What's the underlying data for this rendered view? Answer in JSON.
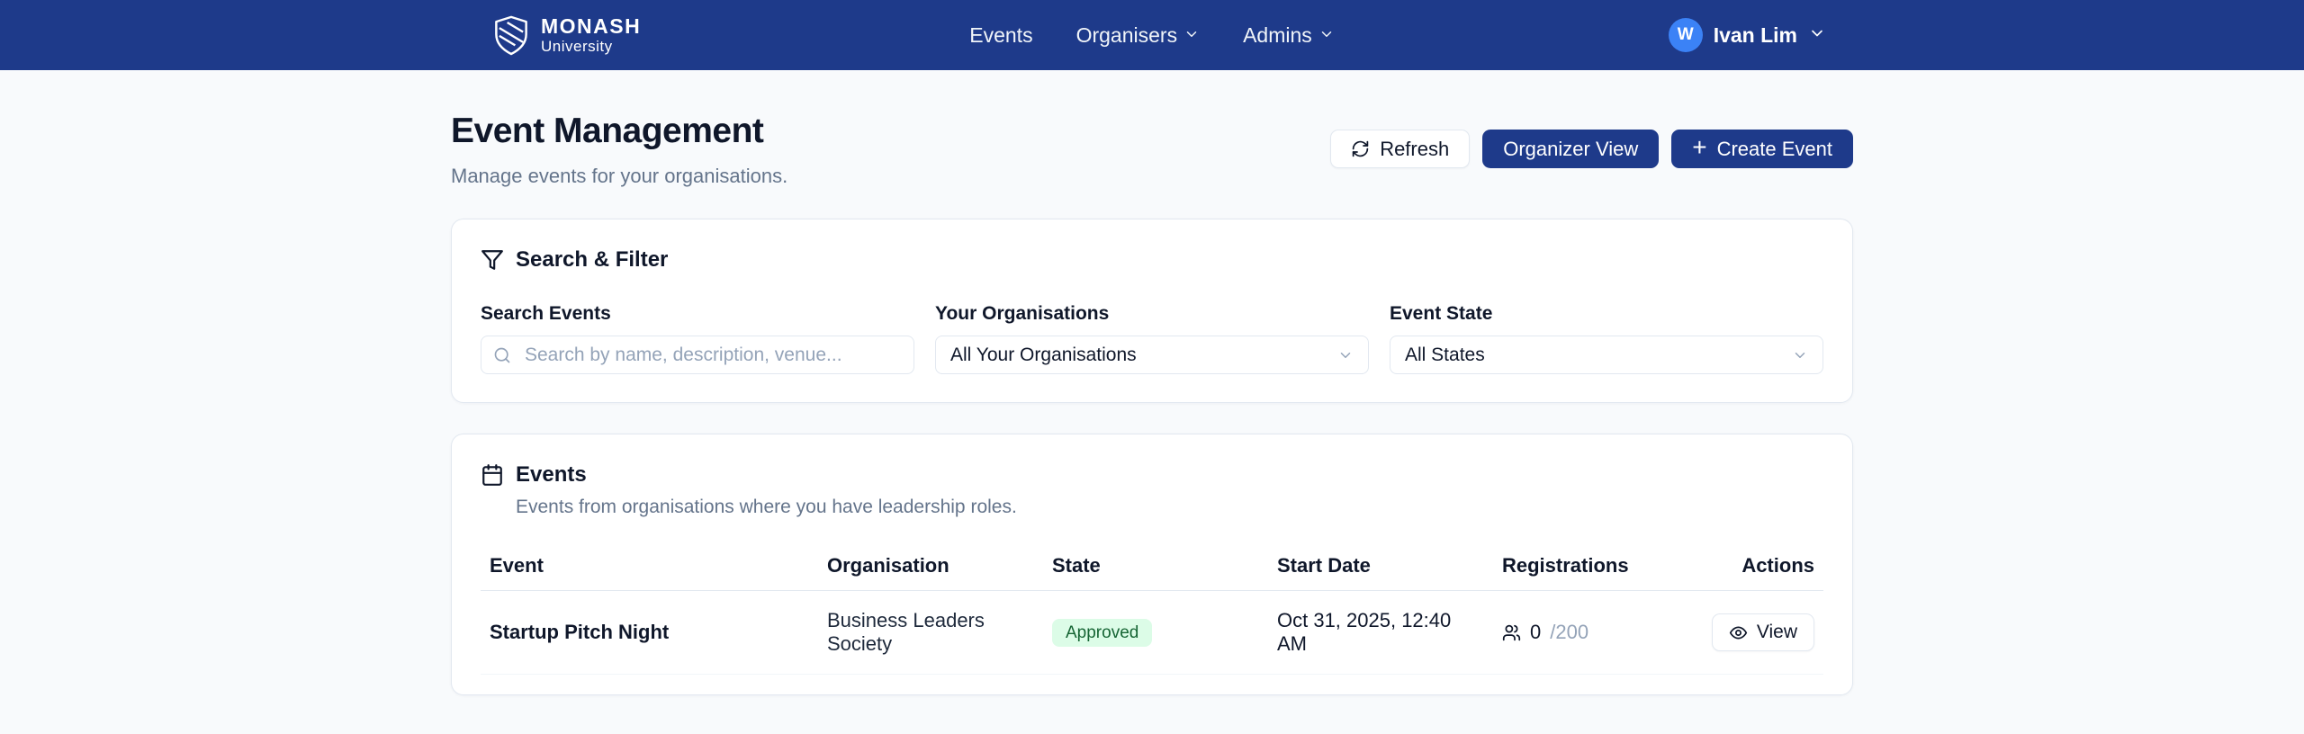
{
  "navbar": {
    "logo": {
      "line1": "MONASH",
      "line2": "University"
    },
    "links": [
      {
        "label": "Events"
      },
      {
        "label": "Organisers"
      },
      {
        "label": "Admins"
      }
    ],
    "user": {
      "initial": "W",
      "name": "Ivan Lim"
    }
  },
  "page": {
    "title": "Event Management",
    "subtitle": "Manage events for your organisations."
  },
  "toolbar": {
    "refresh_label": "Refresh",
    "organizer_view_label": "Organizer View",
    "create_event_label": "Create Event"
  },
  "icons": {
    "plus": "+"
  },
  "filter_card": {
    "title": "Search & Filter",
    "fields": {
      "search": {
        "label": "Search Events",
        "placeholder": "Search by name, description, venue..."
      },
      "organisations": {
        "label": "Your Organisations",
        "value": "All Your Organisations"
      },
      "state": {
        "label": "Event State",
        "value": "All States"
      }
    }
  },
  "events_card": {
    "title": "Events",
    "subtitle": "Events from organisations where you have leadership roles.",
    "table": {
      "headers": [
        "Event",
        "Organisation",
        "State",
        "Start Date",
        "Registrations",
        "Actions"
      ],
      "rows": [
        {
          "event": "Startup Pitch Night",
          "organisation": "Business Leaders Society",
          "state": "Approved",
          "start_date": "Oct 31, 2025, 12:40 AM",
          "registrations_count": "0",
          "registrations_capacity": "/200",
          "action_label": "View"
        }
      ]
    }
  },
  "colors": {
    "navbar_bg": "#1e3a8a",
    "primary_button": "#1e3a8a",
    "avatar_bg": "#3b82f6",
    "badge_bg": "#dcfce7",
    "badge_text": "#166534",
    "page_bg": "#f8fafc"
  }
}
